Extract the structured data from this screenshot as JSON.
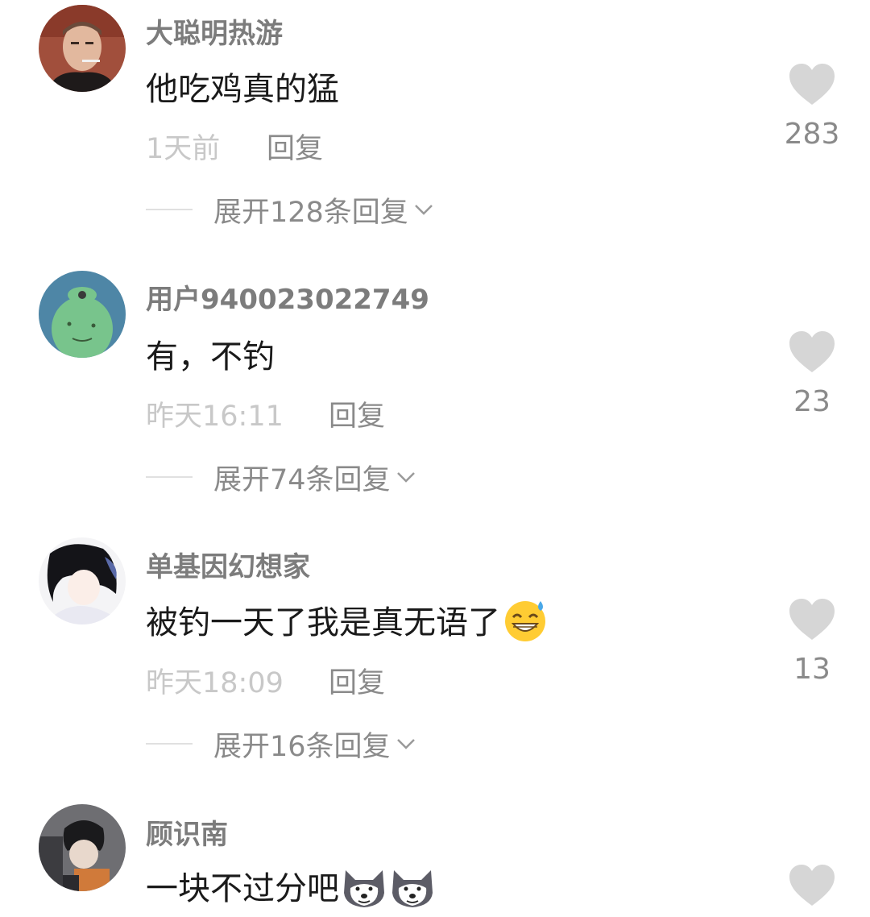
{
  "comments": [
    {
      "username": "大聪明热游",
      "text": "他吃鸡真的猛",
      "time": "1天前",
      "reply_label": "回复",
      "likes": "283",
      "expand_label": "展开128条回复",
      "avatar": "man-smoking-avatar"
    },
    {
      "username": "用户940023022749",
      "text": "有，不钓",
      "time": "昨天16:11",
      "reply_label": "回复",
      "likes": "23",
      "expand_label": "展开74条回复",
      "avatar": "green-frog-avatar"
    },
    {
      "username": "单基因幻想家",
      "text": "被钓一天了我是真无语了",
      "emoji": "grinning-sweat-emoji",
      "time": "昨天18:09",
      "reply_label": "回复",
      "likes": "13",
      "expand_label": "展开16条回复",
      "avatar": "anime-girl-avatar"
    },
    {
      "username": "顾识南",
      "text": "一块不过分吧",
      "emoji": "doge-emoji",
      "avatar": "anime-boy-avatar"
    }
  ],
  "colors": {
    "username": "#7c7c7c",
    "content": "#1a1a1a",
    "time": "#c8c8c8",
    "secondary": "#8a8a8a",
    "heart": "#d6d6d6"
  }
}
